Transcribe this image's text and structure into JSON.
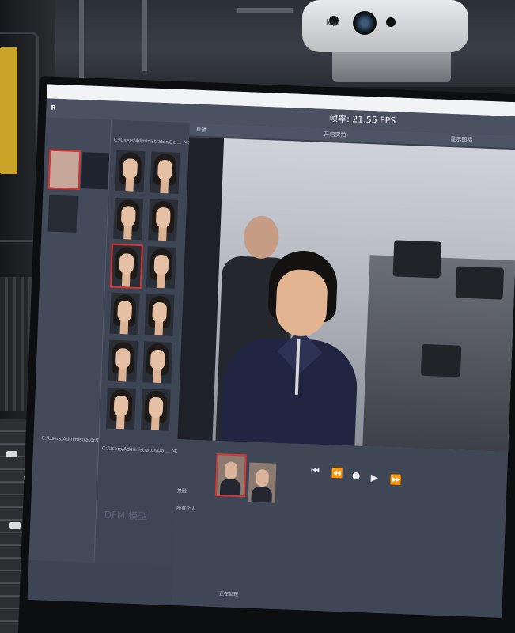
{
  "webcam": {
    "brand": "logi"
  },
  "app": {
    "title": "",
    "logo": "R",
    "menu_items": [
      "",
      ""
    ],
    "fps_label": "帧率: 21.55 FPS"
  },
  "left_panel": {
    "title": "",
    "path": ""
  },
  "middle_panel": {
    "title": "",
    "path": "C:/Users/Administrator/De ... /423",
    "bottom_title": "",
    "bottom_path": "C:/Users/Administrator/Do ... /423",
    "watermark": "DFM 模型",
    "face_count": 12
  },
  "left_bottom": {
    "path": "C:/Users/Administrator/De ... /423"
  },
  "right_panel": {
    "tabs": [
      "直播",
      "开启实拍",
      "显示图标"
    ]
  },
  "controls": {
    "options": [
      "",
      "",
      "换脸",
      "所有个人"
    ],
    "buttons": [
      "⏮",
      "⏪",
      "●",
      "▶",
      "⏩"
    ],
    "status": "正在处理"
  }
}
